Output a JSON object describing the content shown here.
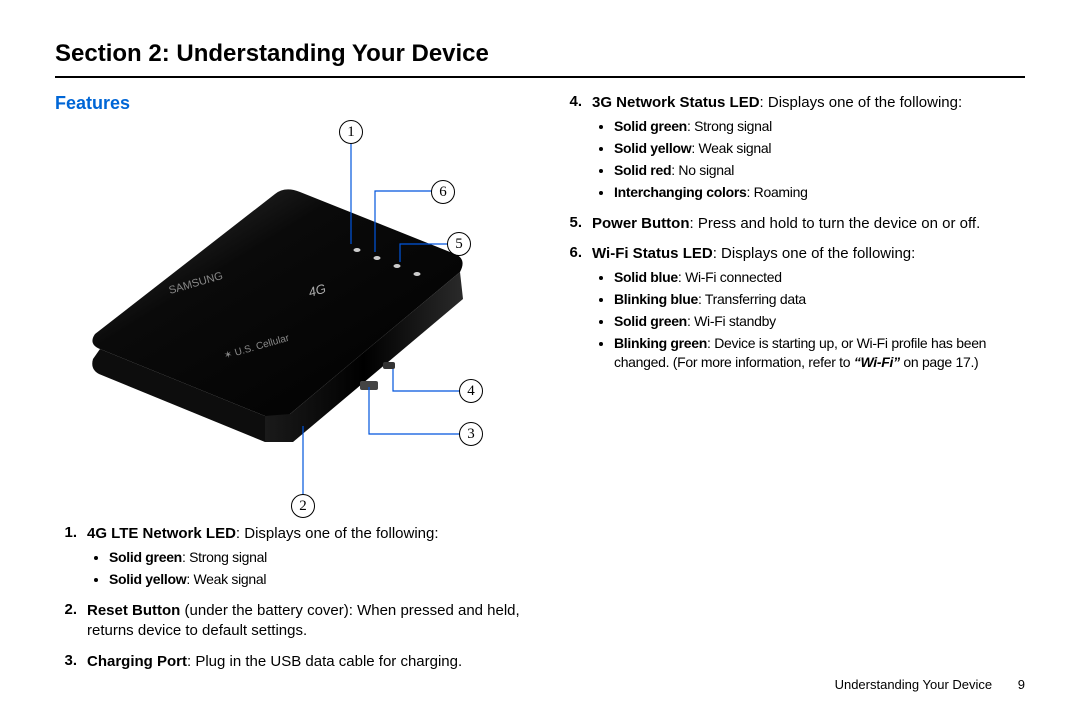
{
  "section_title": "Section 2: Understanding Your Device",
  "sub_title": "Features",
  "callouts": {
    "c1": "1",
    "c2": "2",
    "c3": "3",
    "c4": "4",
    "c5": "5",
    "c6": "6"
  },
  "left_list": {
    "n1": "1.",
    "n2": "2.",
    "n3": "3.",
    "item1_label": "4G LTE Network LED",
    "item1_desc": ": Displays one of the following:",
    "item1_bullets": {
      "b1_label": "Solid green",
      "b1_rest": ": Strong signal",
      "b2_label": "Solid yellow",
      "b2_rest": ": Weak signal"
    },
    "item2_label": "Reset Button",
    "item2_desc": " (under the battery cover): When pressed and held, returns device to default settings.",
    "item3_label": "Charging Port",
    "item3_desc": ": Plug in the USB data cable for charging."
  },
  "right_list": {
    "n4": "4.",
    "n5": "5.",
    "n6": "6.",
    "item4_label": "3G Network Status LED",
    "item4_desc": ": Displays one of the following:",
    "item4_bullets": {
      "b1_label": "Solid green",
      "b1_rest": ": Strong signal",
      "b2_label": "Solid yellow",
      "b2_rest": ": Weak signal",
      "b3_label": "Solid red",
      "b3_rest": ": No signal",
      "b4_label": "Interchanging colors",
      "b4_rest": ": Roaming"
    },
    "item5_label": "Power Button",
    "item5_desc": ": Press and hold to turn the device on or off.",
    "item6_label": "Wi-Fi Status LED",
    "item6_desc": ": Displays one of the following:",
    "item6_bullets": {
      "b1_label": "Solid blue",
      "b1_rest": ": Wi-Fi connected",
      "b2_label": "Blinking blue",
      "b2_rest": ": Transferring data",
      "b3_label": "Solid green",
      "b3_rest": ": Wi-Fi standby",
      "b4_label": "Blinking green",
      "b4_rest1": ": Device is starting up, or Wi-Fi profile has been changed. (For more information, refer to ",
      "b4_link": "“Wi-Fi”",
      "b4_rest2": " on page 17.)"
    }
  },
  "footer": {
    "chapter": "Understanding Your Device",
    "page": "9"
  }
}
